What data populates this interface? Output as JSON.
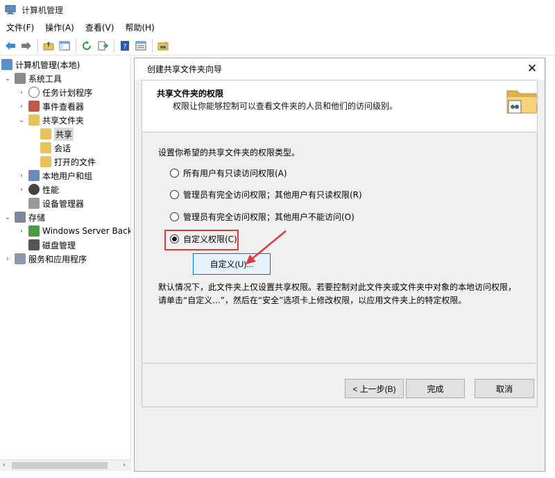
{
  "window": {
    "title": "计算机管理"
  },
  "menu": [
    "文件(F)",
    "操作(A)",
    "查看(V)",
    "帮助(H)"
  ],
  "toolbar": {
    "icons": [
      "back-arrow-icon",
      "forward-arrow-icon",
      "up-folder-icon",
      "show-hide-tree-icon",
      "refresh-icon",
      "export-list-icon",
      "help-icon",
      "properties-icon",
      "share-folder-icon"
    ]
  },
  "tree": {
    "items": [
      {
        "label": "计算机管理(本地)",
        "icon": "computer-management-icon"
      },
      {
        "label": "系统工具",
        "icon": "system-tools-icon"
      },
      {
        "label": "任务计划程序",
        "icon": "task-scheduler-icon"
      },
      {
        "label": "事件查看器",
        "icon": "event-viewer-icon"
      },
      {
        "label": "共享文件夹",
        "icon": "shared-folders-icon"
      },
      {
        "label": "共享",
        "icon": "shares-icon"
      },
      {
        "label": "会话",
        "icon": "sessions-icon"
      },
      {
        "label": "打开的文件",
        "icon": "open-files-icon"
      },
      {
        "label": "本地用户和组",
        "icon": "local-users-icon"
      },
      {
        "label": "性能",
        "icon": "performance-icon"
      },
      {
        "label": "设备管理器",
        "icon": "device-manager-icon"
      },
      {
        "label": "存储",
        "icon": "storage-icon"
      },
      {
        "label": "Windows Server Back",
        "icon": "windows-server-backup-icon"
      },
      {
        "label": "磁盘管理",
        "icon": "disk-management-icon"
      },
      {
        "label": "服务和应用程序",
        "icon": "services-apps-icon"
      }
    ]
  },
  "dialog": {
    "title": "创建共享文件夹向导",
    "header_title": "共享文件夹的权限",
    "header_subtitle": "权限让你能够控制可以查看文件夹的人员和他们的访问级别。",
    "prompt": "设置你希望的共享文件夹的权限类型。",
    "options": [
      {
        "label": "所有用户有只读访问权限(A)",
        "checked": false
      },
      {
        "label": "管理员有完全访问权限；其他用户有只读权限(R)",
        "checked": false
      },
      {
        "label": "管理员有完全访问权限；其他用户不能访问(O)",
        "checked": false
      },
      {
        "label": "自定义权限(C)",
        "checked": true
      }
    ],
    "custom_button": "自定义(U)...",
    "note": "默认情况下，此文件夹上仅设置共享权限。若要控制对此文件夹或文件夹中对象的本地访问权限，请单击“自定义...”，然后在“安全”选项卡上修改权限，以应用文件夹上的特定权限。",
    "back_button": "< 上一步(B)",
    "finish_button": "完成",
    "cancel_button": "取消",
    "close_glyph": "✕"
  },
  "colors": {
    "highlight_box": "#e23a3a",
    "annotation_arrow": "#e23a3a",
    "focus_border": "#0078d7"
  }
}
